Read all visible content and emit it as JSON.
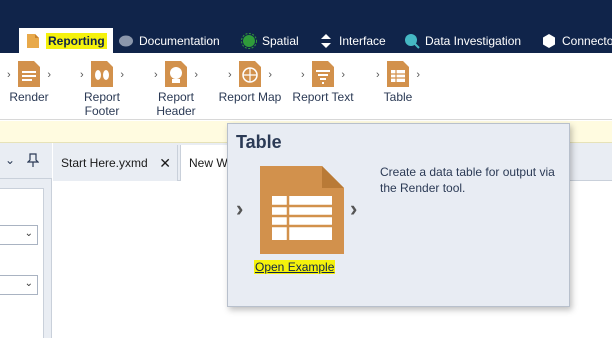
{
  "categories": [
    {
      "label": "Reporting",
      "icon": "reporting-icon",
      "active": true
    },
    {
      "label": "Documentation",
      "icon": "documentation-icon"
    },
    {
      "label": "Spatial",
      "icon": "spatial-icon"
    },
    {
      "label": "Interface",
      "icon": "interface-icon"
    },
    {
      "label": "Data Investigation",
      "icon": "data-investigation-icon"
    },
    {
      "label": "Connector",
      "icon": "connector-icon"
    }
  ],
  "tools": [
    {
      "label": "Render",
      "icon": "render-icon"
    },
    {
      "label": "Report\nFooter",
      "icon": "report-footer-icon"
    },
    {
      "label": "Report\nHeader",
      "icon": "report-header-icon"
    },
    {
      "label": "Report Map",
      "icon": "report-map-icon"
    },
    {
      "label": "Report Text",
      "icon": "report-text-icon"
    },
    {
      "label": "Table",
      "icon": "table-icon"
    }
  ],
  "doc_tabs": [
    {
      "label": "Start Here.yxmd",
      "close": "✕"
    },
    {
      "label": "New Wo"
    }
  ],
  "tooltip": {
    "title": "Table",
    "description": "Create a data table for output via the Render tool.",
    "link": "Open Example"
  },
  "colors": {
    "navy": "#10244a",
    "highlight": "#f5f20c",
    "tool_orange": "#d2914c"
  }
}
